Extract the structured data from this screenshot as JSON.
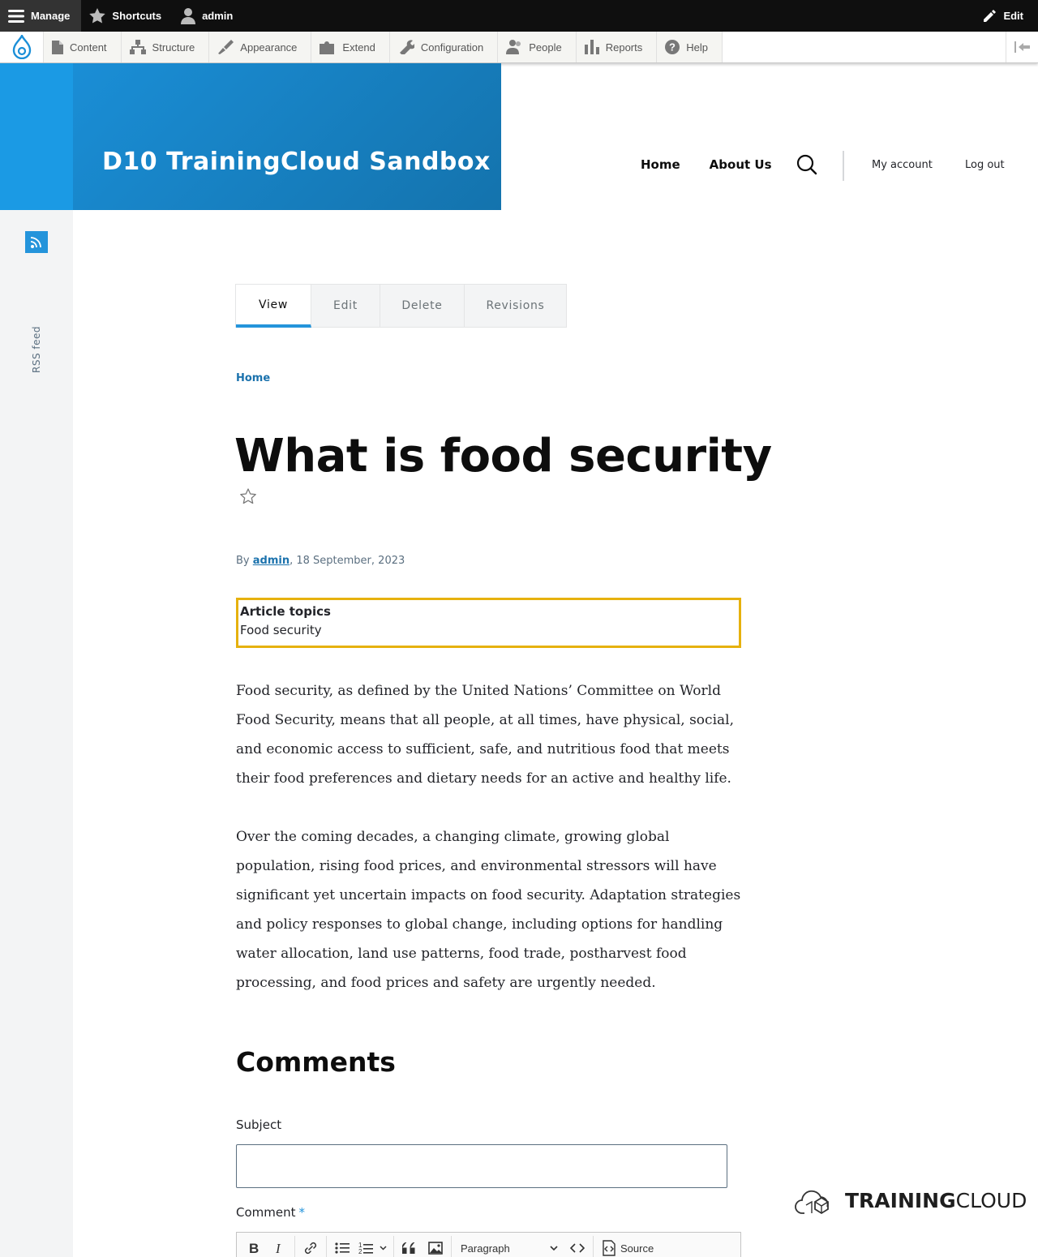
{
  "toolbar": {
    "manage": "Manage",
    "shortcuts": "Shortcuts",
    "user": "admin",
    "edit": "Edit"
  },
  "tray": {
    "items": [
      {
        "label": "Content",
        "icon": "file-icon"
      },
      {
        "label": "Structure",
        "icon": "structure-icon"
      },
      {
        "label": "Appearance",
        "icon": "paintbrush-icon"
      },
      {
        "label": "Extend",
        "icon": "puzzle-icon"
      },
      {
        "label": "Configuration",
        "icon": "wrench-icon"
      },
      {
        "label": "People",
        "icon": "people-icon"
      },
      {
        "label": "Reports",
        "icon": "bar-chart-icon"
      },
      {
        "label": "Help",
        "icon": "question-icon"
      }
    ]
  },
  "branding": {
    "site_name": "D10 TrainingCloud Sandbox"
  },
  "nav": {
    "home": "Home",
    "about": "About Us",
    "my_account": "My account",
    "log_out": "Log out"
  },
  "social": {
    "rss_label": "RSS feed"
  },
  "tabs": {
    "view": "View",
    "edit": "Edit",
    "delete": "Delete",
    "revisions": "Revisions"
  },
  "breadcrumb": {
    "home": "Home"
  },
  "article": {
    "title": "What is food security",
    "by": "By",
    "author": "admin",
    "date": ", 18 September, 2023",
    "topics_label": "Article topics",
    "topics_value": "Food security",
    "paragraph_1": "Food security, as defined by the United Nations’ Committee on World Food Security, means that all people, at all times, have physical, social, and economic access to sufficient, safe, and nutritious food that meets their food preferences and dietary needs for an active and healthy life.",
    "paragraph_2": "Over the coming decades, a changing climate, growing global population, rising food prices, and environmental stressors will have significant yet uncertain impacts on food security. Adaptation strategies and policy responses to global change, including options for handling water allocation, land use patterns, food trade, postharvest food processing, and food prices and safety are urgently needed."
  },
  "comments": {
    "title": "Comments",
    "subject_label": "Subject",
    "subject_value": "",
    "comment_label": "Comment",
    "required_mark": "*",
    "format_select": "Paragraph",
    "source_label": "Source"
  },
  "logo": {
    "bold": "TRAINING",
    "light": "CLOUD"
  },
  "colors": {
    "brand_blue": "#1b9ae4",
    "link_blue": "#1b72ad",
    "highlight": "#e6b10e",
    "toolbar_dark": "#0f0f0f"
  }
}
